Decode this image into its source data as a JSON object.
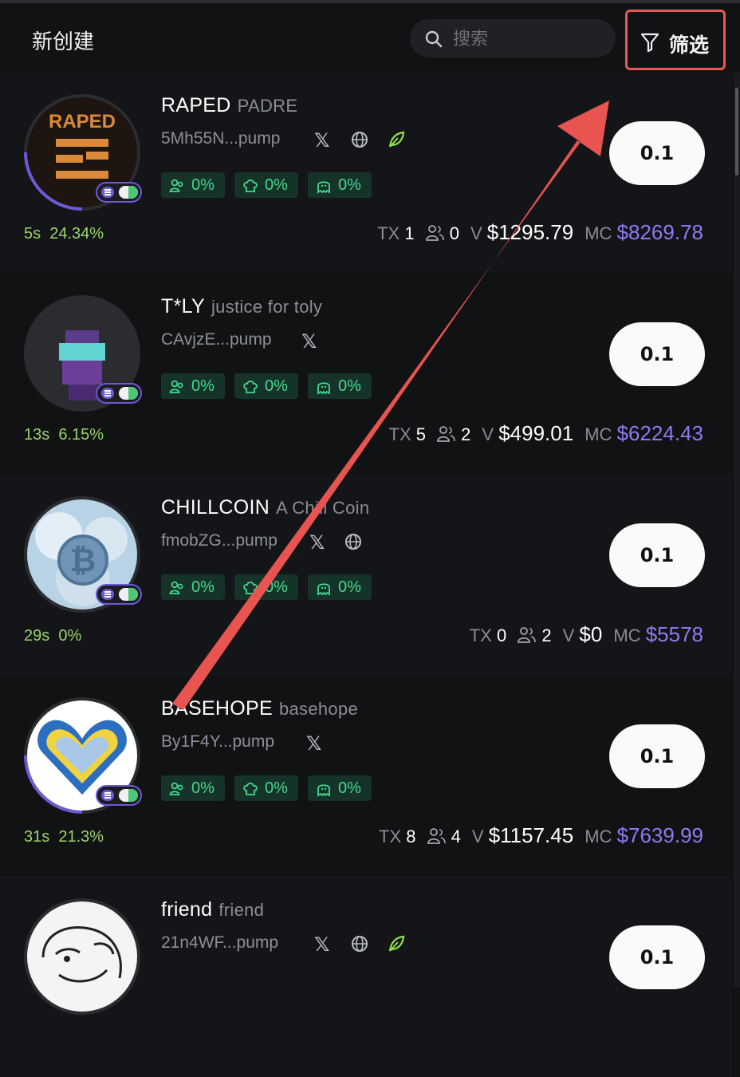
{
  "header": {
    "title": "新创建",
    "search_placeholder": "搜索",
    "filter_label": "筛选"
  },
  "colors": {
    "accent_red": "#e65b55",
    "chip_green": "#44d98d",
    "age_green": "#9ad46b",
    "mc_purple": "#8c7bf0"
  },
  "tokens": [
    {
      "name": "RAPED",
      "subtitle": "PADRE",
      "address": "5Mh55N...pump",
      "icons": [
        "x-icon",
        "globe-icon",
        "leaf-icon"
      ],
      "stats": [
        "0%",
        "0%",
        "0%"
      ],
      "buy": "0.1",
      "age": "5s",
      "pct": "24.34%",
      "tx_label": "TX",
      "tx": "1",
      "holders": "0",
      "v_label": "V",
      "volume": "$1295.79",
      "mc_label": "MC",
      "mc": "$8269.78"
    },
    {
      "name": "T*LY",
      "subtitle": "justice for toly",
      "address": "CAvjzE...pump",
      "icons": [
        "x-icon"
      ],
      "stats": [
        "0%",
        "0%",
        "0%"
      ],
      "buy": "0.1",
      "age": "13s",
      "pct": "6.15%",
      "tx_label": "TX",
      "tx": "5",
      "holders": "2",
      "v_label": "V",
      "volume": "$499.01",
      "mc_label": "MC",
      "mc": "$6224.43"
    },
    {
      "name": "CHILLCOIN",
      "subtitle": "A Chill Coin",
      "address": "fmobZG...pump",
      "icons": [
        "x-icon",
        "globe-icon"
      ],
      "stats": [
        "0%",
        "0%",
        "0%"
      ],
      "buy": "0.1",
      "age": "29s",
      "pct": "0%",
      "tx_label": "TX",
      "tx": "0",
      "holders": "2",
      "v_label": "V",
      "volume": "$0",
      "mc_label": "MC",
      "mc": "$5578"
    },
    {
      "name": "BASEHOPE",
      "subtitle": "basehope",
      "address": "By1F4Y...pump",
      "icons": [
        "x-icon"
      ],
      "stats": [
        "0%",
        "0%",
        "0%"
      ],
      "buy": "0.1",
      "age": "31s",
      "pct": "21.3%",
      "tx_label": "TX",
      "tx": "8",
      "holders": "4",
      "v_label": "V",
      "volume": "$1157.45",
      "mc_label": "MC",
      "mc": "$7639.99"
    },
    {
      "name": "friend",
      "subtitle": "friend",
      "address": "21n4WF...pump",
      "icons": [
        "x-icon",
        "globe-icon",
        "leaf-icon"
      ],
      "buy": "0.1"
    }
  ]
}
